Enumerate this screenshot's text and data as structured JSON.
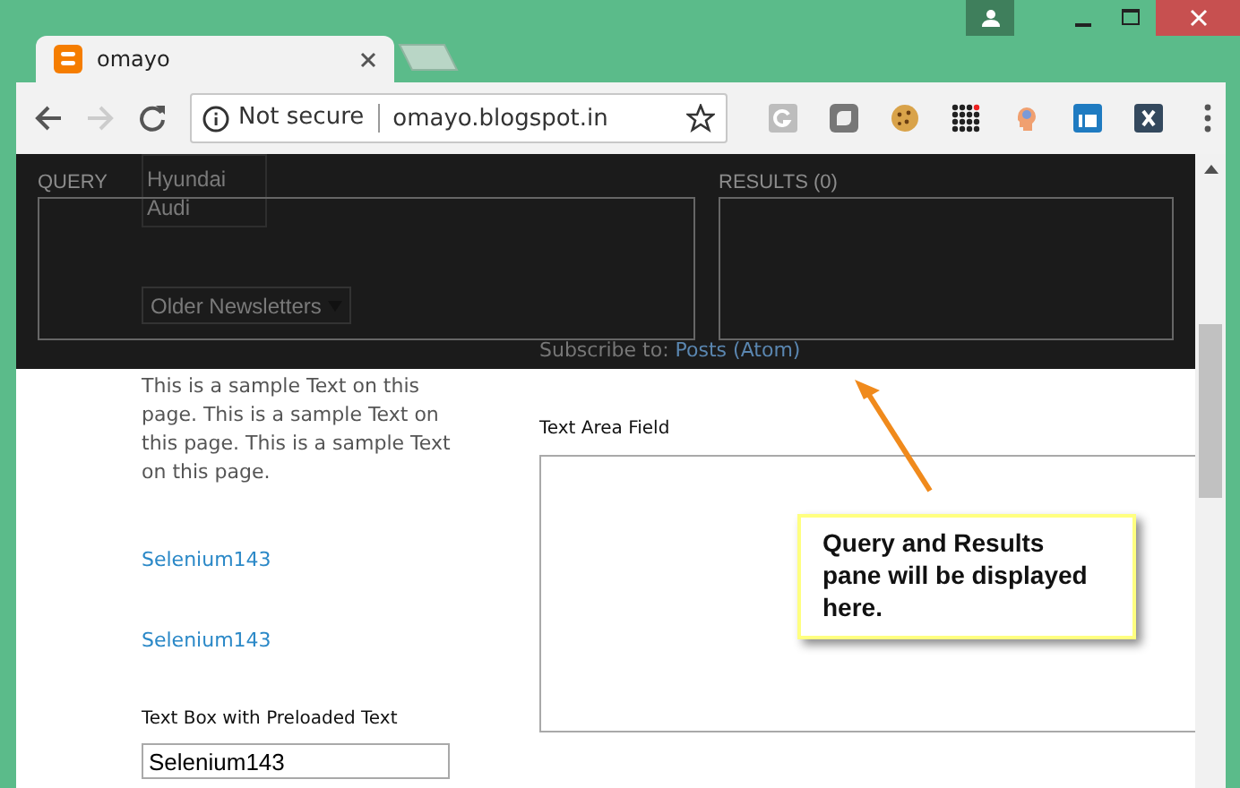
{
  "tabs": [
    {
      "label": "omayo",
      "selected": true
    }
  ],
  "address_bar": {
    "security": "Not secure",
    "url": "omayo.blogspot.in"
  },
  "overlay": {
    "query_label": "QUERY",
    "results_label": "RESULTS (0)"
  },
  "background": {
    "list_options": [
      "Hyundai",
      "Audi"
    ],
    "newsletter_select": "Older Newsletters",
    "subscribe_text": "Subscribe to:",
    "subscribe_link": "Posts (Atom)"
  },
  "page": {
    "sample_text": "This is a sample Text on this page. This is a sample Text on this page. This is a sample Text on this page.",
    "links": [
      "Selenium143",
      "Selenium143"
    ],
    "textbox_label": "Text Box with Preloaded Text",
    "textbox_value": "Selenium143",
    "textarea_label": "Text Area Field"
  },
  "callout": {
    "text": "Query and Results pane will be displayed here."
  }
}
